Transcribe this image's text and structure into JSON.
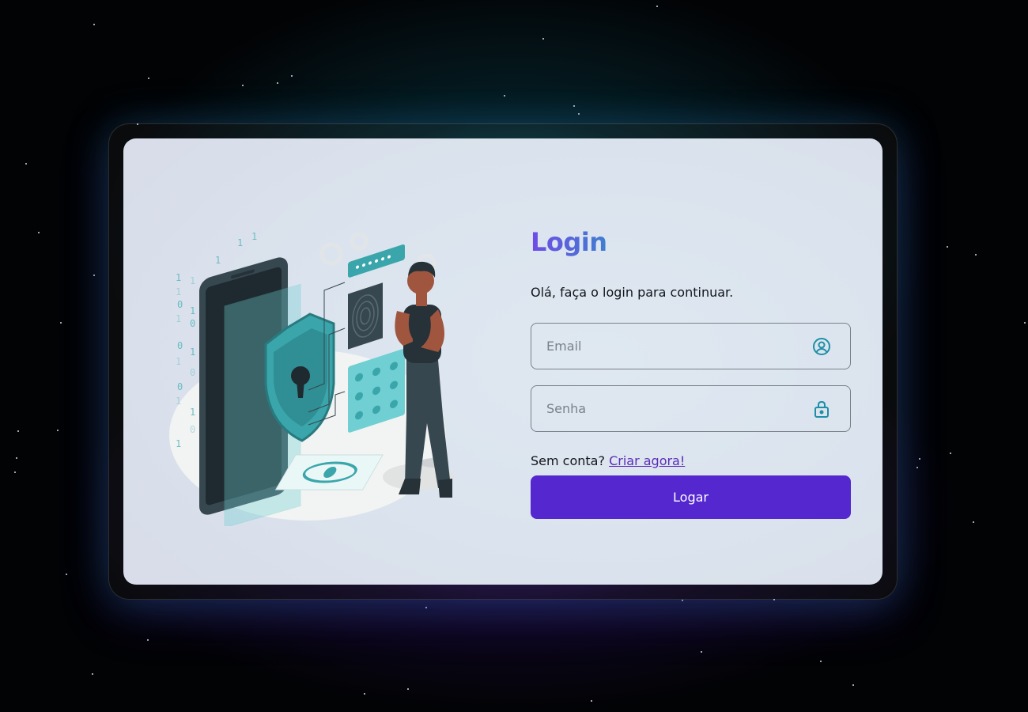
{
  "login": {
    "title": "Login",
    "subtitle": "Olá, faça o login para continuar.",
    "email_placeholder": "Email",
    "password_placeholder": "Senha",
    "no_account_text": "Sem conta?",
    "create_link": "Criar agora!",
    "submit_label": "Logar"
  },
  "colors": {
    "accent": "#5427cf",
    "link": "#5b2bb8",
    "illustration_teal": "#3bb4b8"
  },
  "icons": {
    "email_field": "user-circle-icon",
    "password_field": "lock-icon"
  }
}
